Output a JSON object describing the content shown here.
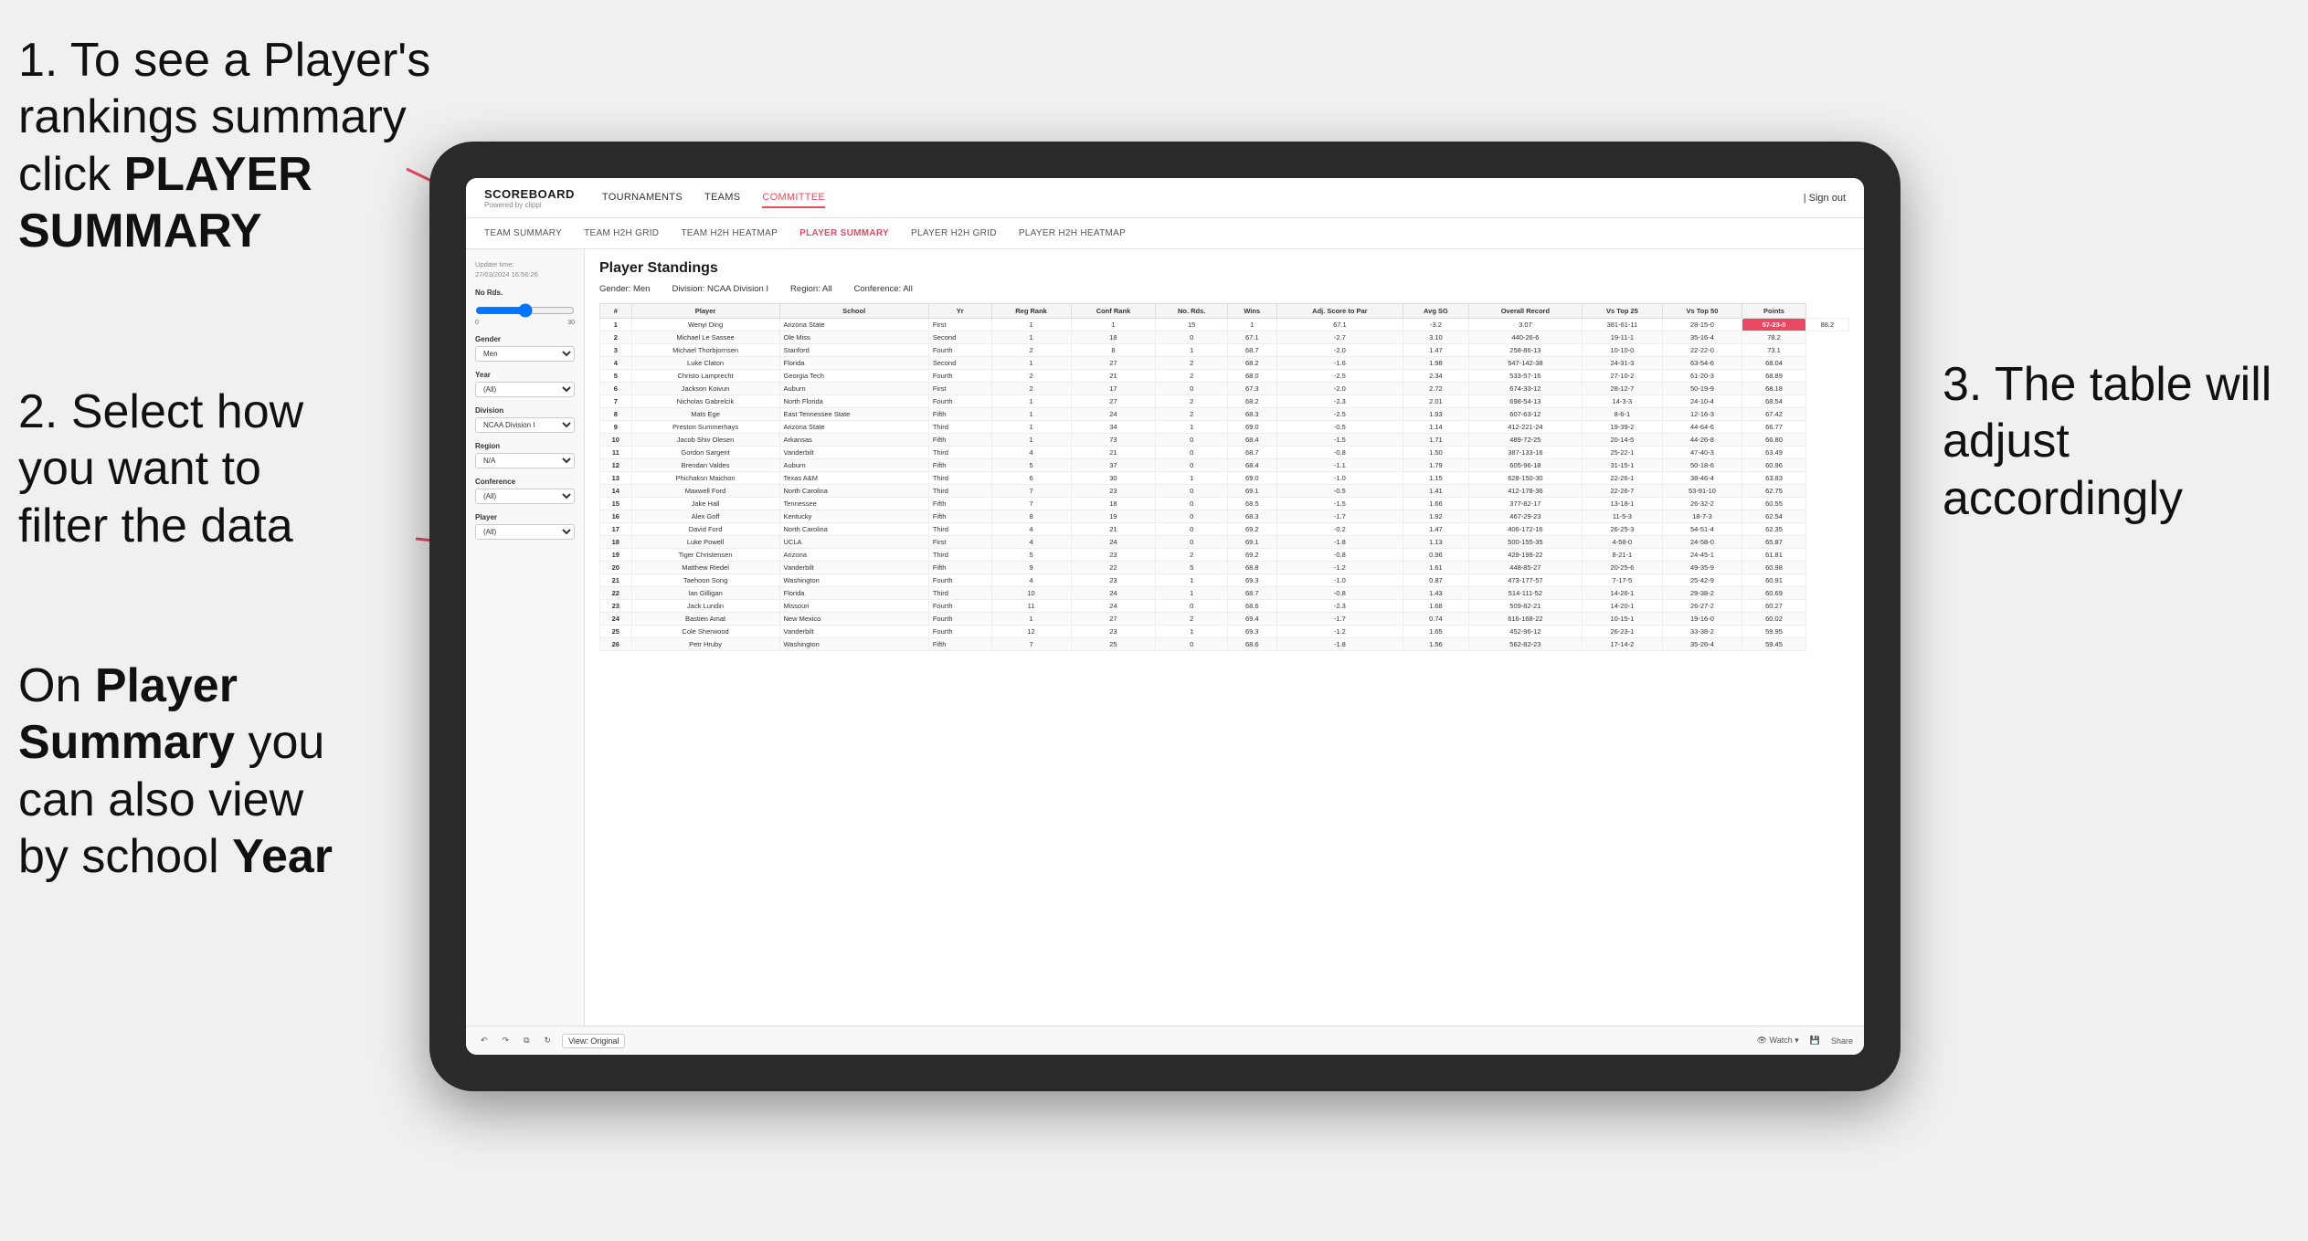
{
  "annotations": {
    "step1": "1. To see a Player's rankings summary click ",
    "step1_bold": "PLAYER SUMMARY",
    "step2_line1": "2. Select how",
    "step2_line2": "you want to",
    "step2_line3": "filter the data",
    "step3_line1": "On ",
    "step3_bold1": "Player",
    "step3_line2": "Summary",
    "step3_rest": " you can also view by school ",
    "step3_bold2": "Year",
    "right_annotation_1": "3. The table will",
    "right_annotation_2": "adjust accordingly"
  },
  "nav": {
    "logo_title": "SCOREBOARD",
    "logo_sub": "Powered by clippi",
    "items": [
      "TOURNAMENTS",
      "TEAMS",
      "COMMITTEE"
    ],
    "sign_out": "Sign out"
  },
  "sub_nav": {
    "items": [
      "TEAM SUMMARY",
      "TEAM H2H GRID",
      "TEAM H2H HEATMAP",
      "PLAYER SUMMARY",
      "PLAYER H2H GRID",
      "PLAYER H2H HEATMAP"
    ]
  },
  "sidebar": {
    "update_label": "Update time:",
    "update_time": "27/03/2024 16:56:26",
    "no_rds_label": "No Rds.",
    "gender_label": "Gender",
    "gender_value": "Men",
    "year_label": "Year",
    "year_value": "(All)",
    "division_label": "Division",
    "division_value": "NCAA Division I",
    "region_label": "Region",
    "region_value": "N/A",
    "conference_label": "Conference",
    "conference_value": "(All)",
    "player_label": "Player",
    "player_value": "(All)"
  },
  "table": {
    "title": "Player Standings",
    "filters": {
      "gender": "Gender: Men",
      "division": "Division: NCAA Division I",
      "region": "Region: All",
      "conference": "Conference: All"
    },
    "columns": [
      "#",
      "Player",
      "School",
      "Yr",
      "Reg Rank",
      "Conf Rank",
      "No. Rds.",
      "Wins",
      "Adj. Score to Par",
      "Avg SG",
      "Overall Record",
      "Vs Top 25",
      "Vs Top 50",
      "Points"
    ],
    "rows": [
      [
        "1",
        "Wenyi Ding",
        "Arizona State",
        "First",
        "1",
        "1",
        "15",
        "1",
        "67.1",
        "-3.2",
        "3.07",
        "381-61-11",
        "28-15-0",
        "57-23-0",
        "88.2"
      ],
      [
        "2",
        "Michael Le Sassee",
        "Ole Miss",
        "Second",
        "1",
        "18",
        "0",
        "67.1",
        "-2.7",
        "3.10",
        "440-26-6",
        "19-11-1",
        "35-16-4",
        "78.2"
      ],
      [
        "3",
        "Michael Thorbjornsen",
        "Stanford",
        "Fourth",
        "2",
        "8",
        "1",
        "68.7",
        "-2.0",
        "1.47",
        "258-86-13",
        "10-10-0",
        "22-22-0",
        "73.1"
      ],
      [
        "4",
        "Luke Claton",
        "Florida",
        "Second",
        "1",
        "27",
        "2",
        "68.2",
        "-1.6",
        "1.98",
        "547-142-38",
        "24-31-3",
        "63-54-6",
        "68.04"
      ],
      [
        "5",
        "Christo Lamprecht",
        "Georgia Tech",
        "Fourth",
        "2",
        "21",
        "2",
        "68.0",
        "-2.5",
        "2.34",
        "533-57-16",
        "27-10-2",
        "61-20-3",
        "68.89"
      ],
      [
        "6",
        "Jackson Koivun",
        "Auburn",
        "First",
        "2",
        "17",
        "0",
        "67.3",
        "-2.0",
        "2.72",
        "674-33-12",
        "28-12-7",
        "50-19-9",
        "68.18"
      ],
      [
        "7",
        "Nicholas Gabrelcik",
        "North Florida",
        "Fourth",
        "1",
        "27",
        "2",
        "68.2",
        "-2.3",
        "2.01",
        "698-54-13",
        "14-3-3",
        "24-10-4",
        "68.54"
      ],
      [
        "8",
        "Mats Ege",
        "East Tennessee State",
        "Fifth",
        "1",
        "24",
        "2",
        "68.3",
        "-2.5",
        "1.93",
        "607-63-12",
        "8-6-1",
        "12-16-3",
        "67.42"
      ],
      [
        "9",
        "Preston Summerhays",
        "Arizona State",
        "Third",
        "1",
        "34",
        "1",
        "69.0",
        "-0.5",
        "1.14",
        "412-221-24",
        "19-39-2",
        "44-64-6",
        "66.77"
      ],
      [
        "10",
        "Jacob Shiv Olesen",
        "Arkansas",
        "Fifth",
        "1",
        "73",
        "0",
        "68.4",
        "-1.5",
        "1.71",
        "489-72-25",
        "20-14-5",
        "44-26-8",
        "66.80"
      ],
      [
        "11",
        "Gordon Sargent",
        "Vanderbilt",
        "Third",
        "4",
        "21",
        "0",
        "68.7",
        "-0.8",
        "1.50",
        "387-133-16",
        "25-22-1",
        "47-40-3",
        "63.49"
      ],
      [
        "12",
        "Brendan Valdes",
        "Auburn",
        "Fifth",
        "5",
        "37",
        "0",
        "68.4",
        "-1.1",
        "1.79",
        "605-96-18",
        "31-15-1",
        "50-18-6",
        "60.96"
      ],
      [
        "13",
        "Phichaksn Maichon",
        "Texas A&M",
        "Third",
        "6",
        "30",
        "1",
        "69.0",
        "-1.0",
        "1.15",
        "628-150-30",
        "22-26-1",
        "38-46-4",
        "63.83"
      ],
      [
        "14",
        "Maxwell Ford",
        "North Carolina",
        "Third",
        "7",
        "23",
        "0",
        "69.1",
        "-0.5",
        "1.41",
        "412-178-36",
        "22-26-7",
        "53-91-10",
        "62.75"
      ],
      [
        "15",
        "Jake Hall",
        "Tennessee",
        "Fifth",
        "7",
        "18",
        "0",
        "68.5",
        "-1.5",
        "1.66",
        "377-82-17",
        "13-18-1",
        "26-32-2",
        "60.55"
      ],
      [
        "16",
        "Alex Goff",
        "Kentucky",
        "Fifth",
        "8",
        "19",
        "0",
        "68.3",
        "-1.7",
        "1.92",
        "467-29-23",
        "11-5-3",
        "18-7-3",
        "62.54"
      ],
      [
        "17",
        "David Ford",
        "North Carolina",
        "Third",
        "4",
        "21",
        "0",
        "69.2",
        "-0.2",
        "1.47",
        "406-172-16",
        "26-25-3",
        "54-51-4",
        "62.35"
      ],
      [
        "18",
        "Luke Powell",
        "UCLA",
        "First",
        "4",
        "24",
        "0",
        "69.1",
        "-1.8",
        "1.13",
        "500-155-35",
        "4-58-0",
        "24-58-0",
        "65.87"
      ],
      [
        "19",
        "Tiger Christensen",
        "Arizona",
        "Third",
        "5",
        "23",
        "2",
        "69.2",
        "-0.8",
        "0.96",
        "429-198-22",
        "8-21-1",
        "24-45-1",
        "61.81"
      ],
      [
        "20",
        "Matthew Riedel",
        "Vanderbilt",
        "Fifth",
        "9",
        "22",
        "5",
        "68.8",
        "-1.2",
        "1.61",
        "448-85-27",
        "20-25-6",
        "49-35-9",
        "60.98"
      ],
      [
        "21",
        "Taehoon Song",
        "Washington",
        "Fourth",
        "4",
        "23",
        "1",
        "69.3",
        "-1.0",
        "0.87",
        "473-177-57",
        "7-17-5",
        "25-42-9",
        "60.91"
      ],
      [
        "22",
        "Ian Gilligan",
        "Florida",
        "Third",
        "10",
        "24",
        "1",
        "68.7",
        "-0.8",
        "1.43",
        "514-111-52",
        "14-26-1",
        "29-38-2",
        "60.69"
      ],
      [
        "23",
        "Jack Lundin",
        "Missouri",
        "Fourth",
        "11",
        "24",
        "0",
        "68.6",
        "-2.3",
        "1.68",
        "509-82-21",
        "14-20-1",
        "26-27-2",
        "60.27"
      ],
      [
        "24",
        "Bastien Amat",
        "New Mexico",
        "Fourth",
        "1",
        "27",
        "2",
        "69.4",
        "-1.7",
        "0.74",
        "616-168-22",
        "10-15-1",
        "19-16-0",
        "60.02"
      ],
      [
        "25",
        "Cole Sherwood",
        "Vanderbilt",
        "Fourth",
        "12",
        "23",
        "1",
        "69.3",
        "-1.2",
        "1.65",
        "452-96-12",
        "26-23-1",
        "33-38-2",
        "59.95"
      ],
      [
        "26",
        "Petr Hruby",
        "Washington",
        "Fifth",
        "7",
        "25",
        "0",
        "68.6",
        "-1.8",
        "1.56",
        "562-82-23",
        "17-14-2",
        "35-26-4",
        "59.45"
      ]
    ]
  },
  "toolbar": {
    "view_label": "View: Original",
    "watch_label": "Watch",
    "share_label": "Share"
  }
}
